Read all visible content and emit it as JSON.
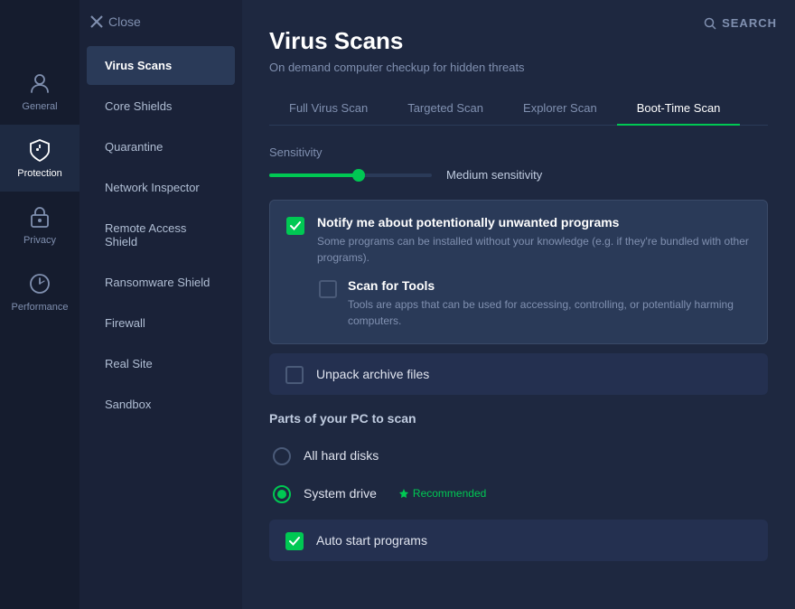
{
  "app": {
    "close_label": "Close",
    "search_label": "SEARCH"
  },
  "sidebar_icons": [
    {
      "id": "general",
      "label": "General",
      "active": false
    },
    {
      "id": "protection",
      "label": "Protection",
      "active": true
    },
    {
      "id": "privacy",
      "label": "Privacy",
      "active": false
    },
    {
      "id": "performance",
      "label": "Performance",
      "active": false
    }
  ],
  "nav": {
    "items": [
      {
        "id": "virus-scans",
        "label": "Virus Scans",
        "active": true
      },
      {
        "id": "core-shields",
        "label": "Core Shields",
        "active": false
      },
      {
        "id": "quarantine",
        "label": "Quarantine",
        "active": false
      },
      {
        "id": "network-inspector",
        "label": "Network Inspector",
        "active": false
      },
      {
        "id": "remote-access-shield",
        "label": "Remote Access Shield",
        "active": false
      },
      {
        "id": "ransomware-shield",
        "label": "Ransomware Shield",
        "active": false
      },
      {
        "id": "firewall",
        "label": "Firewall",
        "active": false
      },
      {
        "id": "real-site",
        "label": "Real Site",
        "active": false
      },
      {
        "id": "sandbox",
        "label": "Sandbox",
        "active": false
      }
    ]
  },
  "main": {
    "title": "Virus Scans",
    "subtitle": "On demand computer checkup for hidden threats",
    "tabs": [
      {
        "id": "full-virus-scan",
        "label": "Full Virus Scan",
        "active": false
      },
      {
        "id": "targeted-scan",
        "label": "Targeted Scan",
        "active": false
      },
      {
        "id": "explorer-scan",
        "label": "Explorer Scan",
        "active": false
      },
      {
        "id": "boot-time-scan",
        "label": "Boot-Time Scan",
        "active": true
      }
    ],
    "sensitivity": {
      "label": "Sensitivity",
      "value": "Medium sensitivity",
      "percent": 55
    },
    "notify_pup": {
      "checked": true,
      "title": "Notify me about potentionally unwanted programs",
      "description": "Some programs can be installed without your knowledge (e.g. if they're bundled with other programs).",
      "sub_option": {
        "checked": false,
        "title": "Scan for Tools",
        "description": "Tools are apps that can be used for accessing, controlling, or potentially harming computers."
      }
    },
    "unpack_archive": {
      "checked": false,
      "label": "Unpack archive files"
    },
    "parts_section": {
      "title": "Parts of your PC to scan",
      "items": [
        {
          "id": "all-hard-disks",
          "label": "All hard disks",
          "radio": "unchecked",
          "recommended": false,
          "recommended_label": ""
        },
        {
          "id": "system-drive",
          "label": "System drive",
          "radio": "checked",
          "recommended": true,
          "recommended_label": "Recommended"
        }
      ]
    },
    "auto_start": {
      "checked": true,
      "label": "Auto start programs"
    }
  }
}
